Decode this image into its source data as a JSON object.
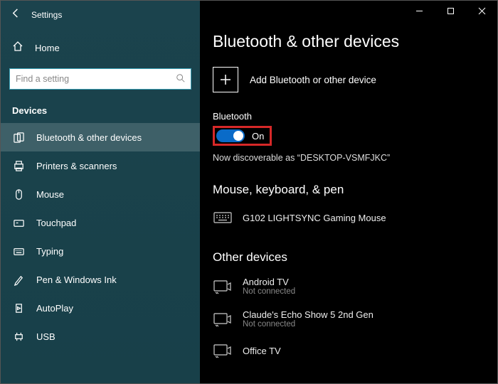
{
  "sidebar": {
    "back_title": "Settings",
    "home_label": "Home",
    "search_placeholder": "Find a setting",
    "section_label": "Devices",
    "items": [
      {
        "label": "Bluetooth & other devices",
        "selected": true
      },
      {
        "label": "Printers & scanners"
      },
      {
        "label": "Mouse"
      },
      {
        "label": "Touchpad"
      },
      {
        "label": "Typing"
      },
      {
        "label": "Pen & Windows Ink"
      },
      {
        "label": "AutoPlay"
      },
      {
        "label": "USB"
      }
    ]
  },
  "main": {
    "title": "Bluetooth & other devices",
    "add_label": "Add Bluetooth or other device",
    "bt_label": "Bluetooth",
    "bt_state": "On",
    "discoverable": "Now discoverable as “DESKTOP-VSMFJKC”",
    "section_mouse": "Mouse, keyboard, & pen",
    "mouse_device": "G102 LIGHTSYNC Gaming Mouse",
    "section_other": "Other devices",
    "other_devices": [
      {
        "name": "Android TV",
        "status": "Not connected"
      },
      {
        "name": "Claude's Echo Show 5 2nd Gen",
        "status": "Not connected"
      },
      {
        "name": "Office TV",
        "status": ""
      }
    ]
  }
}
